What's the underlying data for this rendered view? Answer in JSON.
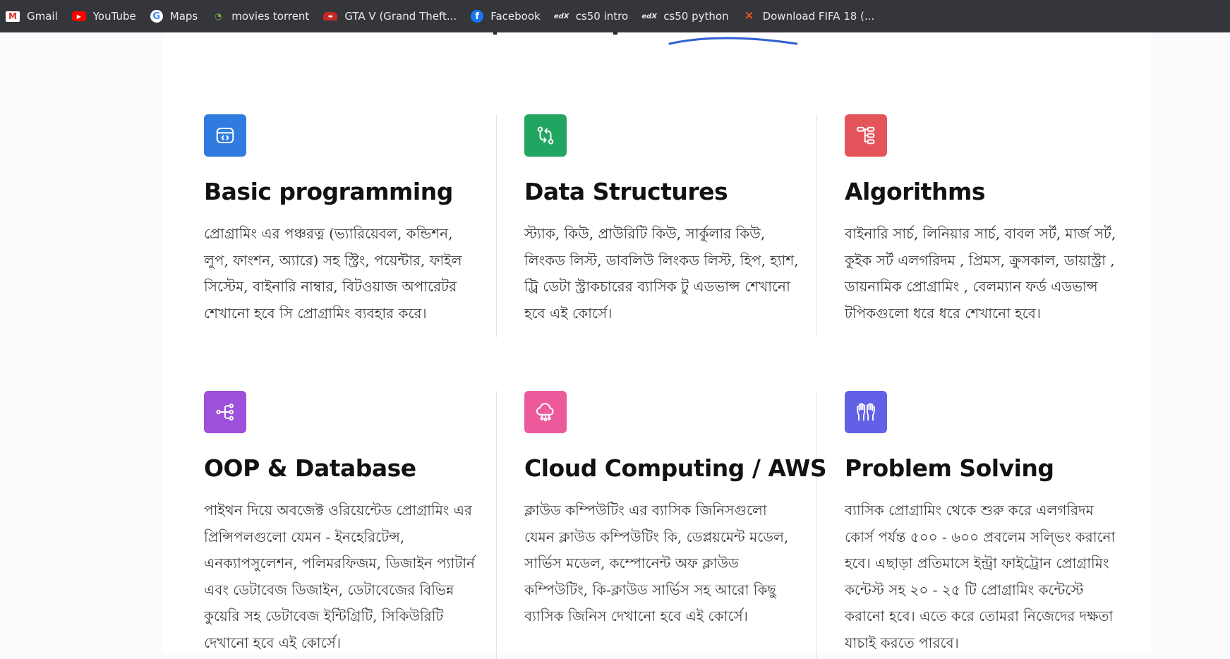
{
  "bookmarks": [
    {
      "label": "Gmail",
      "icon": "gmail-icon",
      "glyph": "M"
    },
    {
      "label": "YouTube",
      "icon": "youtube-icon",
      "glyph": "▶"
    },
    {
      "label": "Maps",
      "icon": "google-icon",
      "glyph": "G"
    },
    {
      "label": "movies torrent",
      "icon": "torrent-icon",
      "glyph": "◔"
    },
    {
      "label": "GTA V (Grand Theft...",
      "icon": "gta-car-icon",
      "glyph": "▬"
    },
    {
      "label": "Facebook",
      "icon": "facebook-icon",
      "glyph": "f"
    },
    {
      "label": "cs50 intro",
      "icon": "edx-icon",
      "glyph": "edX"
    },
    {
      "label": "cs50 python",
      "icon": "edx-icon",
      "glyph": "edX"
    },
    {
      "label": "Download FIFA 18 (...",
      "icon": "fifa-x-icon",
      "glyph": "✕"
    }
  ],
  "colors": {
    "bar_bg": "#35363a",
    "accent_line": "#2f5fd3",
    "blue": "#2f7be0",
    "green": "#22a560",
    "red": "#e5545a",
    "purple": "#9d50d9",
    "pink": "#ec5a9b",
    "indigo": "#6160e6"
  },
  "cards": [
    {
      "title": "Basic programming",
      "icon": "code-browser-icon",
      "color": "#2f7be0",
      "desc": "প্রোগ্রামিং এর পঞ্চরত্ন (ভ্যারিয়েবল, কন্ডিশন, লুপ, ফাংশন, অ্যারে) সহ স্ট্রিং, পয়েন্টার, ফাইল সিস্টেম, বাইনারি নাম্বার, বিটওয়াজ অপারেটর শেখানো হবে সি প্রোগ্রামিং ব্যবহার করে।"
    },
    {
      "title": "Data Structures",
      "icon": "git-compare-icon",
      "color": "#22a560",
      "desc": "স্ট্যাক, কিউ, প্রাউরিটি কিউ, সার্কুলার কিউ, লিংকড লিস্ট, ডাবলিউ লিংকড লিস্ট, হিপ, হ্যাশ, ট্রি ডেটা স্ট্রাকচারের ব্যাসিক টু এডভান্স শেখানো হবে এই কোর্সে।"
    },
    {
      "title": "Algorithms",
      "icon": "hierarchy-icon",
      "color": "#e5545a",
      "desc": "বাইনারি সার্চ, লিনিয়ার সার্চ, বাবল সর্ট, মার্জ সর্ট, কুইক সর্ট এলগরিদম , প্রিমস, ক্রুসকাল, ডায়াস্ট্রা , ডায়নামিক প্রোগ্রামিং , বেলম্যান ফর্ড এডভান্স টপিকগুলো ধরে ধরে শেখানো হবে।"
    },
    {
      "title": "OOP & Database",
      "icon": "share-nodes-icon",
      "color": "#9d50d9",
      "desc": "পাইথন দিয়ে অবজেক্ট ওরিয়েন্টেড প্রোগ্রামিং এর প্রিন্সিপলগুলো যেমন - ইনহেরিটেন্স, এনক্যাপসুলেশন, পলিমরফিজম, ডিজাইন প্যাটার্ন এবং ডেটাবেজ ডিজাইন, ডেটাবেজের বিভিন্ন কুয়েরি সহ ডেটাবেজ ইন্টিগ্রিটি, সিকিউরিটি দেখানো হবে এই কোর্সে।"
    },
    {
      "title": "Cloud Computing / AWS",
      "icon": "cloud-network-icon",
      "color": "#ec5a9b",
      "desc": "ক্লাউড কম্পিউটিং এর ব্যাসিক জিনিসগুলো যেমন ক্লাউড কম্পিউটিং কি, ডেপ্লয়মেন্ট মডেল, সার্ভিস মডেল, কম্পোনেন্ট অফ ক্লাউড কম্পিউটিং, কি-ক্লাউড সার্ভিস সহ আরো কিছু ব্যাসিক জিনিস দেখানো হবে এই কোর্সে।"
    },
    {
      "title": "Problem Solving",
      "icon": "hands-raised-icon",
      "color": "#6160e6",
      "desc": "ব্যাসিক প্রোগ্রামিং থেকে শুরু করে এলগরিদম কোর্স পর্যন্ত ৫০০ - ৬০০ প্রবলেম সল্ভিং করানো হবে। এছাড়া প্রতিমাসে ইন্ট্রা ফাইট্রোন প্রোগ্রামিং কন্টেস্ট সহ ২০ - ২৫ টি প্রোগ্রামিং কন্টেস্টে করানো হবে। এতে করে তোমরা নিজেদের দক্ষতা যাচাই করতে পারবে।"
    }
  ]
}
